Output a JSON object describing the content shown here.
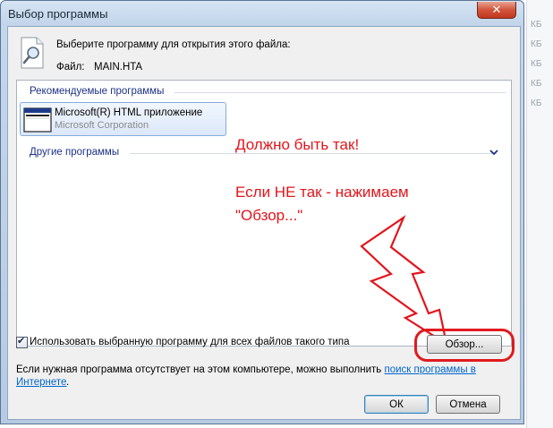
{
  "window": {
    "title": "Выбор программы",
    "close_symbol": "✕"
  },
  "header": {
    "prompt": "Выберите программу для открытия этого файла:",
    "file_label": "Файл:",
    "file_name": "MAIN.HTA"
  },
  "list": {
    "recommended_header": "Рекомендуемые программы",
    "recommended_items": [
      {
        "name": "Microsoft(R) HTML приложение",
        "vendor": "Microsoft Corporation"
      }
    ],
    "other_header": "Другие программы"
  },
  "annotations": {
    "should_be": "Должно быть так!",
    "if_not_line1": "Если НЕ так - нажимаем",
    "if_not_line2": "\"Обзор...\"",
    "color": "#e3141b"
  },
  "footer": {
    "always_use_checked": true,
    "always_use_label": "Использовать выбранную программу для всех файлов такого типа",
    "browse_label": "Обзор...",
    "note_text": "Если нужная программа отсутствует на этом компьютере, можно выполнить",
    "note_link_part1": "поиск программы в",
    "note_link_part2": "Интернете",
    "note_end": ".",
    "ok_label": "ОК",
    "cancel_label": "Отмена"
  },
  "background": {
    "fragments": [
      "КБ",
      "КБ",
      "КБ",
      "КБ",
      "КБ"
    ]
  },
  "icons": [
    "file-search-icon",
    "app-window-icon",
    "chevron-down-icon",
    "close-icon",
    "lightning-arrow-icon",
    "checkmark-icon"
  ]
}
